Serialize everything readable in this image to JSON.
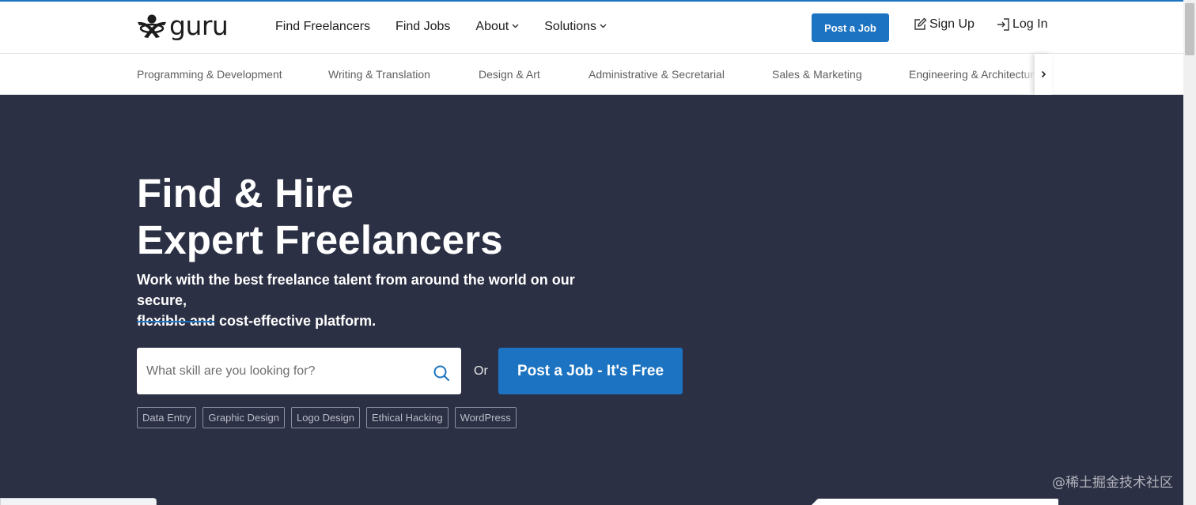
{
  "header": {
    "logo_text": "guru",
    "nav": [
      {
        "label": "Find Freelancers",
        "dropdown": false
      },
      {
        "label": "Find Jobs",
        "dropdown": false
      },
      {
        "label": "About",
        "dropdown": true
      },
      {
        "label": "Solutions",
        "dropdown": true
      }
    ],
    "post_job_label": "Post a Job",
    "sign_up_label": "Sign Up",
    "log_in_label": "Log In"
  },
  "categories": [
    "Programming & Development",
    "Writing & Translation",
    "Design & Art",
    "Administrative & Secretarial",
    "Sales & Marketing",
    "Engineering & Architecture"
  ],
  "hero": {
    "title_line1": "Find & Hire",
    "title_line2": "Expert Freelancers",
    "subtitle_line1": "Work with the best freelance talent from around the world on our secure,",
    "subtitle_line2": "flexible and cost-effective platform.",
    "search_placeholder": "What skill are you looking for?",
    "search_value": "",
    "or_text": "Or",
    "post_job_free_label": "Post a Job - It's Free",
    "tags": [
      "Data Entry",
      "Graphic Design",
      "Logo Design",
      "Ethical Hacking",
      "WordPress"
    ]
  },
  "watermark": "@稀土掘金技术社区",
  "colors": {
    "brand_blue": "#1c73c1",
    "hero_bg": "#2c3044",
    "text_dark": "#1d1d1d",
    "category_text": "#5f5f5f"
  },
  "icons": {
    "logo": "guru-logo-icon",
    "sign_up": "edit-pencil-icon",
    "log_in": "login-arrow-icon",
    "search": "search-icon",
    "dropdown": "chevron-down-icon",
    "category_scroll": "chevron-right-icon"
  }
}
